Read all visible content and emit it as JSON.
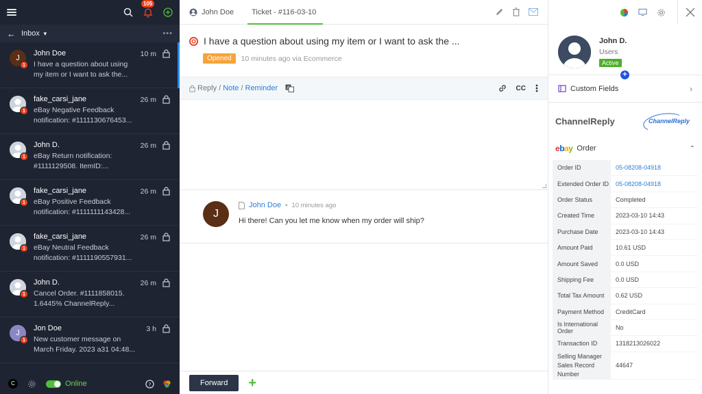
{
  "sidebar": {
    "notifications_count": "105",
    "folder_label": "Inbox",
    "conversations": [
      {
        "initial": "J",
        "name": "John Doe",
        "preview": "I have a question about using my item or I want to ask the...",
        "time": "10 m",
        "unread": "1",
        "avatar": "letter"
      },
      {
        "initial": "",
        "name": "fake_carsi_jane",
        "preview": "eBay Negative Feedback notification: #1111130676453...",
        "time": "26 m",
        "unread": "1",
        "avatar": "silhouette"
      },
      {
        "initial": "",
        "name": "John D.",
        "preview": "eBay Return notification: #1111129508. ItemID:...",
        "time": "26 m",
        "unread": "1",
        "avatar": "silhouette"
      },
      {
        "initial": "",
        "name": "fake_carsi_jane",
        "preview": "eBay Positive Feedback notification: #1111111143428...",
        "time": "26 m",
        "unread": "1",
        "avatar": "silhouette"
      },
      {
        "initial": "",
        "name": "fake_carsi_jane",
        "preview": "eBay Neutral Feedback notification: #1111190557931...",
        "time": "26 m",
        "unread": "1",
        "avatar": "silhouette"
      },
      {
        "initial": "",
        "name": "John D.",
        "preview": "Cancel Order. #1111858015. 1.6445% ChannelReply...",
        "time": "26 m",
        "unread": "1",
        "avatar": "silhouette"
      },
      {
        "initial": "J",
        "name": "Jon Doe",
        "preview": "New customer message on March Friday. 2023 a31 04:48...",
        "time": "3 h",
        "unread": "1",
        "avatar": "purple"
      }
    ],
    "user_initial": "C",
    "status_label": "Online"
  },
  "topbar": {
    "contact_name": "John Doe",
    "ticket_label": "Ticket - #116-03-10"
  },
  "ticket": {
    "subject": "I have a question about using my item or I want to ask the ...",
    "status": "Opened",
    "meta": "10 minutes ago via Ecommerce"
  },
  "reply": {
    "reply_label": "Reply",
    "sep1": "/",
    "note_label": "Note",
    "sep2": "/",
    "reminder_label": "Reminder",
    "cc_label": "CC"
  },
  "message": {
    "initial": "J",
    "sender": "John Doe",
    "dot": "•",
    "time": "10 minutes ago",
    "body": "Hi there! Can you let me know when my order will ship?"
  },
  "footer": {
    "forward_label": "Forward",
    "add_symbol": "+"
  },
  "profile": {
    "name": "John D.",
    "role": "Users",
    "status": "Active",
    "add_symbol": "+"
  },
  "custom_fields_label": "Custom Fields",
  "channelreply": {
    "title": "ChannelReply",
    "logo_text": "ChannelReply",
    "order_label": "Order",
    "ebay": {
      "e": "e",
      "b": "b",
      "a": "a",
      "y": "y"
    },
    "rows": [
      {
        "key": "Order ID",
        "value": "05-08208-04918",
        "link": true
      },
      {
        "key": "Extended Order ID",
        "value": "05-08208-04918",
        "link": true
      },
      {
        "key": "Order Status",
        "value": "Completed",
        "link": false
      },
      {
        "key": "Created Time",
        "value": "2023-03-10 14:43",
        "link": false
      },
      {
        "key": "Purchase Date",
        "value": "2023-03-10 14:43",
        "link": false
      },
      {
        "key": "Amount Paid",
        "value": "10.61 USD",
        "link": false
      },
      {
        "key": "Amount Saved",
        "value": "0.0 USD",
        "link": false
      },
      {
        "key": "Shipping Fee",
        "value": "0.0 USD",
        "link": false
      },
      {
        "key": "Total Tax Amount",
        "value": "0.62 USD",
        "link": false
      },
      {
        "key": "Payment Method",
        "value": "CreditCard",
        "link": false
      },
      {
        "key": "Is International Order",
        "value": "No",
        "link": false
      },
      {
        "key": "Transaction ID",
        "value": "1318213026022",
        "link": false
      },
      {
        "key": "Selling Manager Sales Record Number",
        "value": "44647",
        "link": false
      }
    ]
  },
  "colors": {
    "sidebar_bg": "#1f2433",
    "accent_green": "#4fbf3a",
    "link_blue": "#2b7fd4",
    "alert_red": "#e8401c",
    "status_orange": "#f6a33a"
  }
}
